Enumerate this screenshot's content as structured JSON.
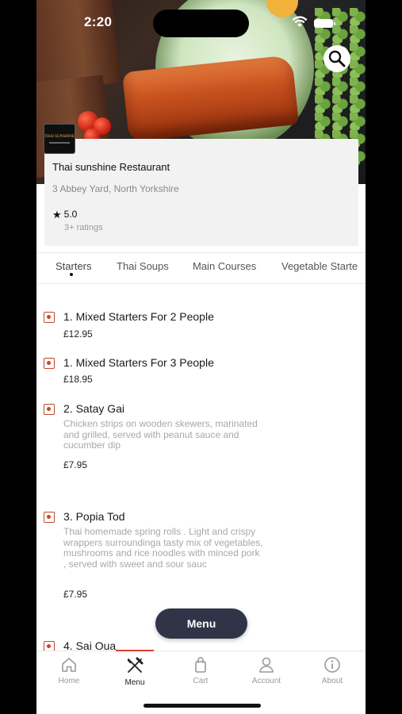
{
  "status_bar": {
    "time": "2:20"
  },
  "restaurant": {
    "name": "Thai sunshine Restaurant",
    "address": "3 Abbey Yard, North Yorkshire",
    "rating": "5.0",
    "ratings_count": "3+ ratings",
    "logo_text": "THAI SUNSHINE"
  },
  "tabs": [
    "Starters",
    "Thai Soups",
    "Main Courses",
    "Vegetable Starte"
  ],
  "items": [
    {
      "name": "1. Mixed Starters For 2 People",
      "desc": "",
      "price": "£12.95"
    },
    {
      "name": "1. Mixed Starters For 3 People",
      "desc": "",
      "price": "£18.95"
    },
    {
      "name": "2. Satay Gai",
      "desc": "Chicken strips on wooden skewers, marinated and grilled, served with peanut sauce and cucumber dip",
      "price": "£7.95"
    },
    {
      "name": "3. Popia Tod",
      "desc": "Thai homemade spring rolls . Light and crispy wrappers surroundinga tasty mix of vegetables, mushrooms and rice noodles with minced pork , served with sweet and sour sauc",
      "price": "£7.95"
    },
    {
      "name": "4. Sai Oua",
      "desc": "",
      "price": ""
    }
  ],
  "menu_button": "Menu",
  "nav": [
    {
      "label": "Home",
      "icon": "home-icon"
    },
    {
      "label": "Menu",
      "icon": "fork-knife-icon"
    },
    {
      "label": "Cart",
      "icon": "bag-icon"
    },
    {
      "label": "Account",
      "icon": "person-icon"
    },
    {
      "label": "About",
      "icon": "info-icon"
    }
  ],
  "colors": {
    "accent": "#d94131",
    "bullet": "#c0492b",
    "fab": "#2f3447"
  }
}
